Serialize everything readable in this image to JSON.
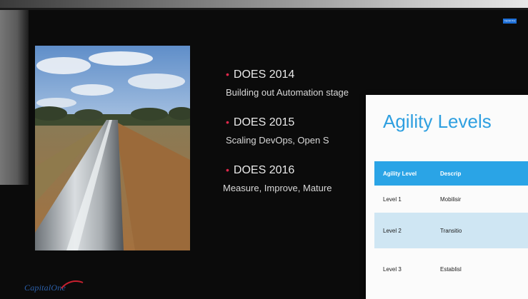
{
  "slide": {
    "bullets": [
      {
        "head": "DOES 2014",
        "sub": "Building out Automation stage"
      },
      {
        "head": "DOES 2015",
        "sub": "Scaling DevOps, Open S"
      },
      {
        "head": "DOES 2016",
        "sub": "Measure, Improve, Mature"
      }
    ],
    "bullet_marker": "•",
    "tag_text": "Capital One",
    "logo_text": "CapitalOne"
  },
  "overlay_slide": {
    "title": "Agility Levels",
    "table": {
      "headers": [
        "Agility Level",
        "Descrip"
      ],
      "rows": [
        [
          "Level 1",
          "Mobilisir"
        ],
        [
          "Level 2",
          "Transitio"
        ],
        [
          "Level 3",
          "Establisl"
        ]
      ]
    }
  },
  "colors": {
    "slide_background": "#0b0b0b",
    "bullet_marker": "#e0284b",
    "overlay_title": "#2e9fe0",
    "table_header": "#2aa4e6",
    "table_alt_row": "#cfe6f3",
    "logo": "#2b5fa9"
  }
}
